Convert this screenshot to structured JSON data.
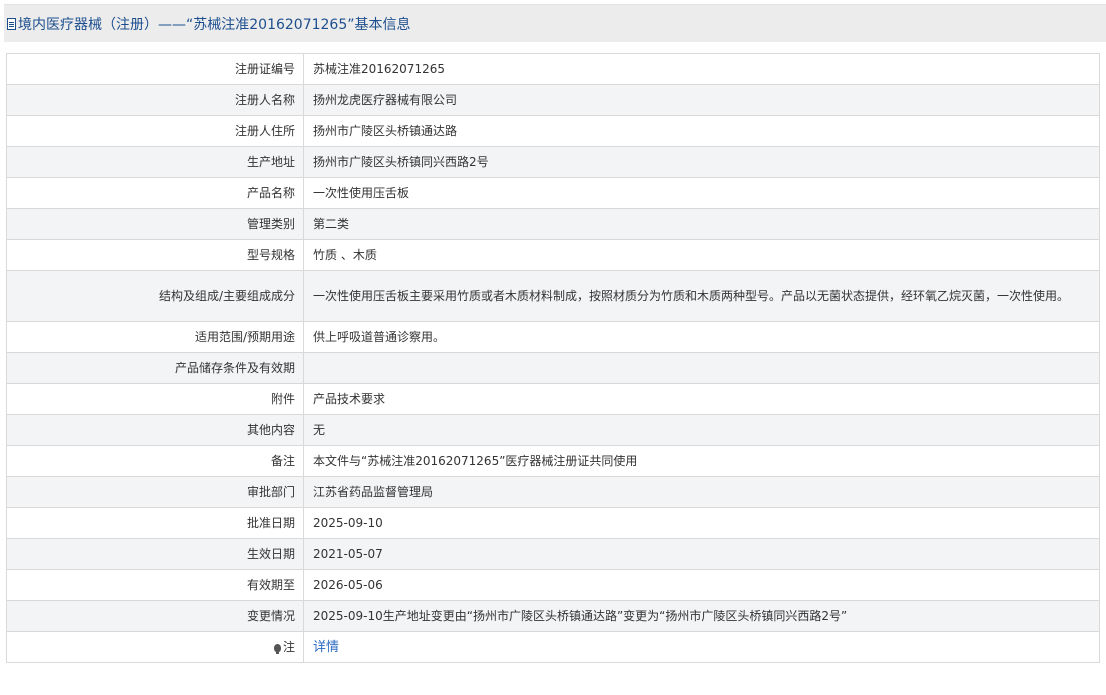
{
  "header": {
    "icon": "document-icon",
    "title": "境内医疗器械（注册）——“苏械注准20162071265”基本信息"
  },
  "rows": [
    {
      "label": "注册证编号",
      "value": "苏械注准20162071265"
    },
    {
      "label": "注册人名称",
      "value": "扬州龙虎医疗器械有限公司"
    },
    {
      "label": "注册人住所",
      "value": "扬州市广陵区头桥镇通达路"
    },
    {
      "label": "生产地址",
      "value": "扬州市广陵区头桥镇同兴西路2号"
    },
    {
      "label": "产品名称",
      "value": "一次性使用压舌板"
    },
    {
      "label": "管理类别",
      "value": "第二类"
    },
    {
      "label": "型号规格",
      "value": "竹质 、木质"
    },
    {
      "label": "结构及组成/主要组成成分",
      "value": "一次性使用压舌板主要采用竹质或者木质材料制成，按照材质分为竹质和木质两种型号。产品以无菌状态提供，经环氧乙烷灭菌，一次性使用。"
    },
    {
      "label": "适用范围/预期用途",
      "value": "供上呼吸道普通诊察用。"
    },
    {
      "label": "产品储存条件及有效期",
      "value": ""
    },
    {
      "label": "附件",
      "value": "产品技术要求"
    },
    {
      "label": "其他内容",
      "value": "无"
    },
    {
      "label": "备注",
      "value": "本文件与“苏械注准20162071265”医疗器械注册证共同使用"
    },
    {
      "label": "审批部门",
      "value": "江苏省药品监督管理局"
    },
    {
      "label": "批准日期",
      "value": "2025-09-10"
    },
    {
      "label": "生效日期",
      "value": "2021-05-07"
    },
    {
      "label": "有效期至",
      "value": "2026-05-06"
    },
    {
      "label": "变更情况",
      "value": "2025-09-10生产地址变更由“扬州市广陵区头桥镇通达路”变更为“扬州市广陵区头桥镇同兴西路2号”"
    }
  ],
  "note": {
    "icon": "bulb-icon",
    "label": "注",
    "link": "详情"
  }
}
